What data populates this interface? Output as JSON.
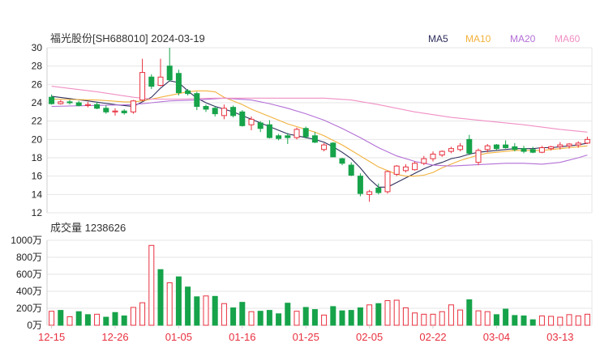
{
  "header": {
    "stock_title": "福光股份[SH688010] 2024-03-19",
    "volume_title": "成交量 1238626"
  },
  "legend": [
    {
      "label": "MA5",
      "color": "#2e2e5c"
    },
    {
      "label": "MA10",
      "color": "#f2b13c"
    },
    {
      "label": "MA20",
      "color": "#b36fd6"
    },
    {
      "label": "MA60",
      "color": "#f08fc4"
    }
  ],
  "colors": {
    "up": "#e8303f",
    "down": "#16a34a",
    "grid": "#e6e6e6",
    "axis_text": "#222222",
    "date_text": "#e8303f"
  },
  "chart_data": [
    {
      "type": "candlestick",
      "title": "福光股份[SH688010] 2024-03-19",
      "ylim": [
        12,
        30
      ],
      "yticks": [
        30,
        28,
        26,
        24,
        22,
        20,
        18,
        16,
        14,
        12
      ],
      "ohlc": [
        [
          24.6,
          24.9,
          23.8,
          23.9
        ],
        [
          23.9,
          24.3,
          23.8,
          24.1
        ],
        [
          24.1,
          24.3,
          23.8,
          24.0
        ],
        [
          24.0,
          24.2,
          23.6,
          23.7
        ],
        [
          23.7,
          24.1,
          23.5,
          23.8
        ],
        [
          23.8,
          24.1,
          23.3,
          23.4
        ],
        [
          23.4,
          23.7,
          22.8,
          23.0
        ],
        [
          23.0,
          23.4,
          22.6,
          23.1
        ],
        [
          23.1,
          23.3,
          22.7,
          22.9
        ],
        [
          23.0,
          24.3,
          22.8,
          24.2
        ],
        [
          24.3,
          28.8,
          24.2,
          27.3
        ],
        [
          26.8,
          27.1,
          25.5,
          25.8
        ],
        [
          25.9,
          28.8,
          25.8,
          26.8
        ],
        [
          28.0,
          30.0,
          26.3,
          26.5
        ],
        [
          27.2,
          27.6,
          24.8,
          25.1
        ],
        [
          25.3,
          25.5,
          24.8,
          25.0
        ],
        [
          25.0,
          25.2,
          23.2,
          23.6
        ],
        [
          23.6,
          23.8,
          23.0,
          23.3
        ],
        [
          23.4,
          23.6,
          22.5,
          22.8
        ],
        [
          22.6,
          23.8,
          22.2,
          23.4
        ],
        [
          23.5,
          23.7,
          22.4,
          22.6
        ],
        [
          23.0,
          23.2,
          21.4,
          21.5
        ],
        [
          21.6,
          22.5,
          21.0,
          22.2
        ],
        [
          21.8,
          22.0,
          20.8,
          21.2
        ],
        [
          21.6,
          22.1,
          20.1,
          20.2
        ],
        [
          20.4,
          20.6,
          19.9,
          20.1
        ],
        [
          20.4,
          20.7,
          19.5,
          20.2
        ],
        [
          20.2,
          21.3,
          20.0,
          21.1
        ],
        [
          21.2,
          21.4,
          20.1,
          20.3
        ],
        [
          20.4,
          20.8,
          19.6,
          19.7
        ],
        [
          18.9,
          19.6,
          18.7,
          19.4
        ],
        [
          19.6,
          19.7,
          18.1,
          18.1
        ],
        [
          17.9,
          18.0,
          17.2,
          17.4
        ],
        [
          17.2,
          17.5,
          16.0,
          16.1
        ],
        [
          16.0,
          16.3,
          13.8,
          14.1
        ],
        [
          14.0,
          14.5,
          13.2,
          14.3
        ],
        [
          14.7,
          15.2,
          14.0,
          14.2
        ],
        [
          14.3,
          16.6,
          14.1,
          16.5
        ],
        [
          16.2,
          17.2,
          16.0,
          17.1
        ],
        [
          16.6,
          17.3,
          16.4,
          17.0
        ],
        [
          16.7,
          17.6,
          16.6,
          17.4
        ],
        [
          17.4,
          18.2,
          17.2,
          17.9
        ],
        [
          17.9,
          18.7,
          17.6,
          18.4
        ],
        [
          18.3,
          18.8,
          18.1,
          18.7
        ],
        [
          18.7,
          19.2,
          18.5,
          19.0
        ],
        [
          18.9,
          19.6,
          18.7,
          19.3
        ],
        [
          20.0,
          20.5,
          18.3,
          18.5
        ],
        [
          17.5,
          19.0,
          17.2,
          18.8
        ],
        [
          18.9,
          19.5,
          18.6,
          19.3
        ],
        [
          19.4,
          19.5,
          18.8,
          19.0
        ],
        [
          19.4,
          19.9,
          19.0,
          19.1
        ],
        [
          19.2,
          19.6,
          18.7,
          18.9
        ],
        [
          19.0,
          19.3,
          18.5,
          18.7
        ],
        [
          18.9,
          19.2,
          18.5,
          18.6
        ],
        [
          18.6,
          19.3,
          18.5,
          19.1
        ],
        [
          19.0,
          19.3,
          18.8,
          19.2
        ],
        [
          19.2,
          19.7,
          18.9,
          19.4
        ],
        [
          19.3,
          19.6,
          19.0,
          19.5
        ],
        [
          19.4,
          19.8,
          19.1,
          19.6
        ],
        [
          19.6,
          20.3,
          19.5,
          20.0
        ]
      ],
      "series": [
        {
          "name": "MA5",
          "color": "#2e2e5c",
          "points": [
            [
              0,
              24.7
            ],
            [
              4,
              24.2
            ],
            [
              7,
              23.8
            ],
            [
              9,
              23.6
            ],
            [
              10,
              24.1
            ],
            [
              11,
              24.6
            ],
            [
              12,
              25.6
            ],
            [
              13,
              26.4
            ],
            [
              14,
              26.2
            ],
            [
              15,
              25.3
            ],
            [
              16,
              24.5
            ],
            [
              17,
              24.0
            ],
            [
              18,
              23.6
            ],
            [
              19,
              23.3
            ],
            [
              20,
              23.0
            ],
            [
              21,
              22.6
            ],
            [
              22,
              22.2
            ],
            [
              23,
              21.8
            ],
            [
              24,
              21.4
            ],
            [
              25,
              21.0
            ],
            [
              26,
              20.6
            ],
            [
              27,
              20.4
            ],
            [
              28,
              20.2
            ],
            [
              29,
              20.0
            ],
            [
              30,
              19.7
            ],
            [
              31,
              19.2
            ],
            [
              32,
              18.6
            ],
            [
              33,
              17.9
            ],
            [
              34,
              16.9
            ],
            [
              35,
              15.7
            ],
            [
              36,
              14.8
            ],
            [
              37,
              14.8
            ],
            [
              38,
              15.3
            ],
            [
              39,
              15.8
            ],
            [
              40,
              16.3
            ],
            [
              41,
              16.8
            ],
            [
              42,
              17.2
            ],
            [
              43,
              17.5
            ],
            [
              44,
              17.9
            ],
            [
              45,
              18.1
            ],
            [
              46,
              18.4
            ],
            [
              47,
              18.6
            ],
            [
              48,
              18.7
            ],
            [
              49,
              18.8
            ],
            [
              50,
              18.9
            ],
            [
              51,
              19.0
            ],
            [
              52,
              19.0
            ],
            [
              53,
              19.0
            ],
            [
              54,
              19.1
            ],
            [
              55,
              19.1
            ],
            [
              56,
              19.2
            ],
            [
              57,
              19.3
            ],
            [
              58,
              19.4
            ],
            [
              59,
              19.6
            ]
          ]
        },
        {
          "name": "MA10",
          "color": "#f2b13c",
          "points": [
            [
              0,
              24.4
            ],
            [
              5,
              24.3
            ],
            [
              8,
              24.1
            ],
            [
              9,
              24.1
            ],
            [
              10,
              24.2
            ],
            [
              11,
              24.4
            ],
            [
              12,
              24.6
            ],
            [
              13,
              24.8
            ],
            [
              14,
              25.0
            ],
            [
              15,
              25.2
            ],
            [
              16,
              25.3
            ],
            [
              17,
              25.3
            ],
            [
              18,
              25.2
            ],
            [
              19,
              24.6
            ],
            [
              20,
              24.2
            ],
            [
              21,
              23.8
            ],
            [
              22,
              23.3
            ],
            [
              23,
              22.9
            ],
            [
              24,
              22.5
            ],
            [
              25,
              22.1
            ],
            [
              26,
              21.7
            ],
            [
              27,
              21.4
            ],
            [
              28,
              21.1
            ],
            [
              29,
              20.8
            ],
            [
              30,
              20.4
            ],
            [
              31,
              19.9
            ],
            [
              32,
              19.4
            ],
            [
              33,
              18.8
            ],
            [
              34,
              18.2
            ],
            [
              35,
              17.6
            ],
            [
              36,
              17.0
            ],
            [
              37,
              16.6
            ],
            [
              38,
              16.2
            ],
            [
              39,
              16.0
            ],
            [
              40,
              16.0
            ],
            [
              41,
              16.1
            ],
            [
              42,
              16.4
            ],
            [
              43,
              16.9
            ],
            [
              44,
              17.3
            ],
            [
              45,
              17.7
            ],
            [
              46,
              18.0
            ],
            [
              47,
              18.3
            ],
            [
              48,
              18.5
            ],
            [
              49,
              18.6
            ],
            [
              50,
              18.7
            ],
            [
              51,
              18.8
            ],
            [
              52,
              18.8
            ],
            [
              53,
              18.8
            ],
            [
              54,
              18.8
            ],
            [
              55,
              18.9
            ],
            [
              56,
              19.0
            ],
            [
              57,
              19.1
            ],
            [
              58,
              19.2
            ],
            [
              59,
              19.3
            ]
          ]
        },
        {
          "name": "MA20",
          "color": "#b36fd6",
          "points": [
            [
              0,
              23.6
            ],
            [
              9,
              23.8
            ],
            [
              11,
              24.0
            ],
            [
              13,
              24.2
            ],
            [
              16,
              24.3
            ],
            [
              19,
              24.5
            ],
            [
              22,
              24.3
            ],
            [
              24,
              23.9
            ],
            [
              26,
              23.4
            ],
            [
              28,
              22.8
            ],
            [
              30,
              22.1
            ],
            [
              32,
              21.2
            ],
            [
              34,
              20.2
            ],
            [
              36,
              19.1
            ],
            [
              38,
              18.2
            ],
            [
              40,
              17.6
            ],
            [
              42,
              17.2
            ],
            [
              44,
              17.1
            ],
            [
              46,
              17.2
            ],
            [
              48,
              17.3
            ],
            [
              50,
              17.4
            ],
            [
              52,
              17.4
            ],
            [
              54,
              17.3
            ],
            [
              56,
              17.5
            ],
            [
              58,
              18.0
            ],
            [
              59,
              18.3
            ]
          ]
        },
        {
          "name": "MA60",
          "color": "#f08fc4",
          "points": [
            [
              0,
              25.8
            ],
            [
              5,
              25.2
            ],
            [
              9,
              24.6
            ],
            [
              11,
              24.4
            ],
            [
              14,
              24.4
            ],
            [
              18,
              24.5
            ],
            [
              24,
              24.5
            ],
            [
              30,
              24.5
            ],
            [
              33,
              24.3
            ],
            [
              36,
              23.8
            ],
            [
              40,
              23.0
            ],
            [
              44,
              22.4
            ],
            [
              48,
              22.0
            ],
            [
              52,
              21.6
            ],
            [
              56,
              21.1
            ],
            [
              59,
              20.8
            ]
          ]
        }
      ]
    },
    {
      "type": "bar",
      "title": "成交量 1238626",
      "unit": "万",
      "ylim": [
        0,
        1000
      ],
      "yticks": [
        1000,
        800,
        600,
        400,
        200,
        0
      ],
      "ytick_labels": [
        "1000万",
        "800万",
        "600万",
        "400万",
        "200万",
        "0万"
      ],
      "values": [
        165,
        175,
        100,
        160,
        125,
        130,
        95,
        150,
        110,
        210,
        265,
        940,
        655,
        500,
        570,
        450,
        335,
        345,
        340,
        255,
        205,
        270,
        160,
        165,
        175,
        135,
        260,
        165,
        210,
        185,
        120,
        220,
        170,
        175,
        205,
        240,
        255,
        290,
        295,
        205,
        145,
        130,
        130,
        160,
        240,
        180,
        300,
        170,
        160,
        125,
        190,
        115,
        110,
        65,
        110,
        105,
        95,
        125,
        110,
        130
      ],
      "up": [
        true,
        false,
        true,
        false,
        false,
        true,
        false,
        false,
        false,
        true,
        true,
        true,
        false,
        true,
        false,
        false,
        false,
        true,
        false,
        true,
        false,
        false,
        true,
        false,
        false,
        false,
        false,
        true,
        false,
        false,
        true,
        false,
        false,
        false,
        false,
        true,
        false,
        true,
        true,
        true,
        true,
        true,
        true,
        true,
        true,
        true,
        false,
        true,
        true,
        false,
        false,
        false,
        false,
        false,
        true,
        true,
        true,
        true,
        true,
        true
      ],
      "xtick_labels": [
        "12-15",
        "12-26",
        "01-05",
        "01-16",
        "01-25",
        "02-05",
        "02-22",
        "03-04",
        "03-13"
      ],
      "xtick_index": [
        0,
        7,
        14,
        21,
        28,
        35,
        42,
        49,
        56
      ]
    }
  ]
}
